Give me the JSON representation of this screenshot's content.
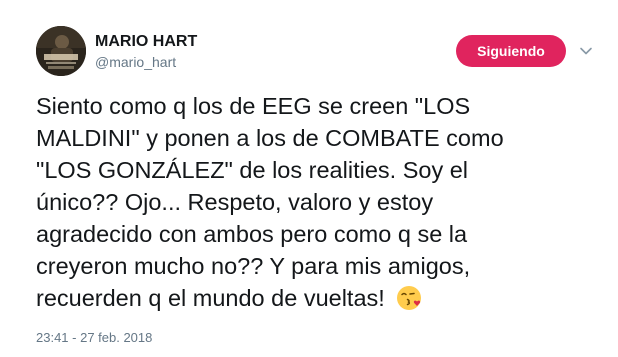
{
  "author": {
    "display_name": "MARIO HART",
    "handle": "@mario_hart",
    "avatar_icon": "profile-photo"
  },
  "follow_button": {
    "label": "Siguiendo",
    "color": "#e0245e"
  },
  "menu": {
    "icon": "chevron-down-icon"
  },
  "tweet": {
    "lines": [
      "Siento como q los de EEG se creen \"LOS",
      "MALDINI\" y ponen a los de COMBATE como",
      "\"LOS GONZÁLEZ\" de los realities. Soy el",
      "único?? Ojo... Respeto, valoro y estoy",
      "agradecido con ambos pero como q se la",
      "creyeron mucho no?? Y para mis amigos,",
      "recuerden q el mundo de vueltas!"
    ],
    "emoji": "face-blowing-a-kiss",
    "timestamp": "23:41 - 27 feb. 2018"
  },
  "colors": {
    "text": "#14171a",
    "secondary_text": "#657786",
    "accent": "#e0245e"
  }
}
